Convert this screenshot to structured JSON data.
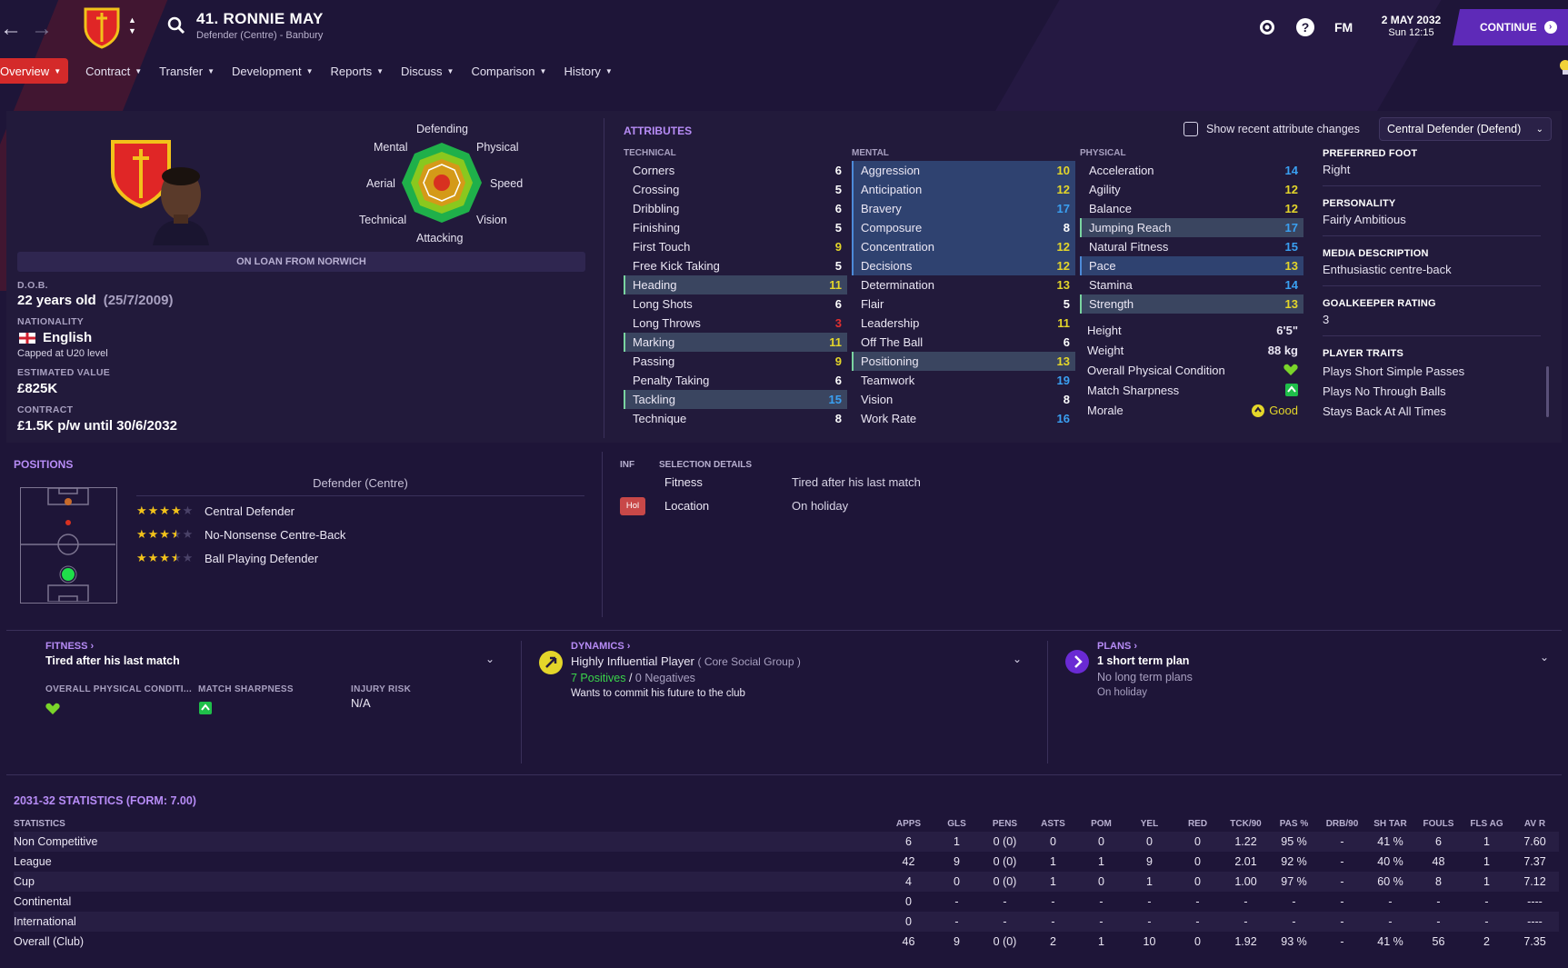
{
  "header": {
    "player_title": "41. RONNIE MAY",
    "player_subtitle": "Defender (Centre) - Banbury",
    "fm_label": "FM",
    "date": "2 MAY 2032",
    "time": "Sun 12:15",
    "continue_label": "CONTINUE"
  },
  "menu": [
    {
      "label": "Overview",
      "active": true
    },
    {
      "label": "Contract"
    },
    {
      "label": "Transfer"
    },
    {
      "label": "Development"
    },
    {
      "label": "Reports"
    },
    {
      "label": "Discuss"
    },
    {
      "label": "Comparison"
    },
    {
      "label": "History"
    }
  ],
  "radar": {
    "labels": {
      "top": "Defending",
      "tl": "Mental",
      "tr": "Physical",
      "l": "Aerial",
      "r": "Speed",
      "bl": "Technical",
      "br": "Vision",
      "bottom": "Attacking"
    }
  },
  "profile": {
    "loan_banner": "ON LOAN FROM NORWICH",
    "dob_label": "D.O.B.",
    "age": "22 years old",
    "dob": "(25/7/2009)",
    "nationality_label": "NATIONALITY",
    "nationality": "English",
    "caps": "Capped at U20 level",
    "value_label": "ESTIMATED VALUE",
    "value": "£825K",
    "contract_label": "CONTRACT",
    "contract": "£1.5K p/w until 30/6/2032"
  },
  "attributes": {
    "title": "ATTRIBUTES",
    "show_changes_label": "Show recent attribute changes",
    "role_select": "Central Defender (Defend)",
    "technical_header": "TECHNICAL",
    "mental_header": "MENTAL",
    "physical_header": "PHYSICAL",
    "technical": [
      {
        "name": "Corners",
        "value": "6",
        "c": "w"
      },
      {
        "name": "Crossing",
        "value": "5",
        "c": "w"
      },
      {
        "name": "Dribbling",
        "value": "6",
        "c": "w"
      },
      {
        "name": "Finishing",
        "value": "5",
        "c": "w"
      },
      {
        "name": "First Touch",
        "value": "9",
        "c": "y"
      },
      {
        "name": "Free Kick Taking",
        "value": "5",
        "c": "w"
      },
      {
        "name": "Heading",
        "value": "11",
        "c": "y",
        "hl": "hl"
      },
      {
        "name": "Long Shots",
        "value": "6",
        "c": "w"
      },
      {
        "name": "Long Throws",
        "value": "3",
        "c": "r"
      },
      {
        "name": "Marking",
        "value": "11",
        "c": "y",
        "hl": "hl"
      },
      {
        "name": "Passing",
        "value": "9",
        "c": "y"
      },
      {
        "name": "Penalty Taking",
        "value": "6",
        "c": "w"
      },
      {
        "name": "Tackling",
        "value": "15",
        "c": "b",
        "hl": "hl"
      },
      {
        "name": "Technique",
        "value": "8",
        "c": "w"
      }
    ],
    "mental": [
      {
        "name": "Aggression",
        "value": "10",
        "c": "y",
        "hl": "hlb"
      },
      {
        "name": "Anticipation",
        "value": "12",
        "c": "y",
        "hl": "hlb"
      },
      {
        "name": "Bravery",
        "value": "17",
        "c": "b",
        "hl": "hlb"
      },
      {
        "name": "Composure",
        "value": "8",
        "c": "w",
        "hl": "hlb"
      },
      {
        "name": "Concentration",
        "value": "12",
        "c": "y",
        "hl": "hlb"
      },
      {
        "name": "Decisions",
        "value": "12",
        "c": "y",
        "hl": "hlb"
      },
      {
        "name": "Determination",
        "value": "13",
        "c": "y"
      },
      {
        "name": "Flair",
        "value": "5",
        "c": "w"
      },
      {
        "name": "Leadership",
        "value": "11",
        "c": "y"
      },
      {
        "name": "Off The Ball",
        "value": "6",
        "c": "w"
      },
      {
        "name": "Positioning",
        "value": "13",
        "c": "y",
        "hl": "hl"
      },
      {
        "name": "Teamwork",
        "value": "19",
        "c": "b"
      },
      {
        "name": "Vision",
        "value": "8",
        "c": "w"
      },
      {
        "name": "Work Rate",
        "value": "16",
        "c": "b"
      }
    ],
    "physical": [
      {
        "name": "Acceleration",
        "value": "14",
        "c": "b"
      },
      {
        "name": "Agility",
        "value": "12",
        "c": "y"
      },
      {
        "name": "Balance",
        "value": "12",
        "c": "y"
      },
      {
        "name": "Jumping Reach",
        "value": "17",
        "c": "b",
        "hl": "hl"
      },
      {
        "name": "Natural Fitness",
        "value": "15",
        "c": "b"
      },
      {
        "name": "Pace",
        "value": "13",
        "c": "y",
        "hl": "hlb"
      },
      {
        "name": "Stamina",
        "value": "14",
        "c": "b"
      },
      {
        "name": "Strength",
        "value": "13",
        "c": "y",
        "hl": "hl"
      }
    ],
    "height_label": "Height",
    "height": "6'5\"",
    "weight_label": "Weight",
    "weight": "88 kg",
    "condition_label": "Overall Physical Condition",
    "sharpness_label": "Match Sharpness",
    "morale_label": "Morale",
    "morale": "Good"
  },
  "info": {
    "foot_label": "PREFERRED FOOT",
    "foot": "Right",
    "personality_label": "PERSONALITY",
    "personality": "Fairly Ambitious",
    "media_label": "MEDIA DESCRIPTION",
    "media": "Enthusiastic centre-back",
    "gk_label": "GOALKEEPER RATING",
    "gk": "3",
    "traits_label": "PLAYER TRAITS",
    "traits": [
      "Plays Short Simple Passes",
      "Plays No Through Balls",
      "Stays Back At All Times"
    ]
  },
  "positions": {
    "title": "POSITIONS",
    "group": "Defender (Centre)",
    "roles": [
      {
        "name": "Central Defender",
        "stars": 4
      },
      {
        "name": "No-Nonsense Centre-Back",
        "stars": 3.5
      },
      {
        "name": "Ball Playing Defender",
        "stars": 3.5
      }
    ]
  },
  "selection": {
    "inf_label": "INF",
    "title": "SELECTION DETAILS",
    "rows": [
      {
        "label": "Fitness",
        "value": "Tired after his last match"
      },
      {
        "label": "Location",
        "value": "On holiday"
      }
    ],
    "hol_badge": "Hol"
  },
  "fitness_card": {
    "title": "FITNESS",
    "headline": "Tired after his last match",
    "opc_label": "OVERALL PHYSICAL CONDITI...",
    "ms_label": "MATCH SHARPNESS",
    "injury_label": "INJURY RISK",
    "injury": "N/A"
  },
  "dynamics_card": {
    "title": "DYNAMICS",
    "headline": "Highly Influential Player",
    "group": "( Core Social Group )",
    "positives": "7 Positives",
    "slash": "/",
    "negatives": "0 Negatives",
    "note": "Wants to commit his future to the club"
  },
  "plans_card": {
    "title": "PLANS",
    "headline": "1 short term plan",
    "line1": "No long term plans",
    "line2": "On holiday"
  },
  "stats": {
    "title": "2031-32 STATISTICS (FORM: 7.00)",
    "columns": [
      "STATISTICS",
      "APPS",
      "GLS",
      "PENS",
      "ASTS",
      "POM",
      "YEL",
      "RED",
      "TCK/90",
      "PAS %",
      "DRB/90",
      "SH TAR",
      "FOULS",
      "FLS AG",
      "AV R"
    ],
    "rows": [
      [
        "Non Competitive",
        "6",
        "1",
        "0 (0)",
        "0",
        "0",
        "0",
        "0",
        "1.22",
        "95 %",
        "-",
        "41 %",
        "6",
        "1",
        "7.60"
      ],
      [
        "League",
        "42",
        "9",
        "0 (0)",
        "1",
        "1",
        "9",
        "0",
        "2.01",
        "92 %",
        "-",
        "40 %",
        "48",
        "1",
        "7.37"
      ],
      [
        "Cup",
        "4",
        "0",
        "0 (0)",
        "1",
        "0",
        "1",
        "0",
        "1.00",
        "97 %",
        "-",
        "60 %",
        "8",
        "1",
        "7.12"
      ],
      [
        "Continental",
        "0",
        "-",
        "-",
        "-",
        "-",
        "-",
        "-",
        "-",
        "-",
        "-",
        "-",
        "-",
        "-",
        "----"
      ],
      [
        "International",
        "0",
        "-",
        "-",
        "-",
        "-",
        "-",
        "-",
        "-",
        "-",
        "-",
        "-",
        "-",
        "-",
        "----"
      ],
      [
        "Overall (Club)",
        "46",
        "9",
        "0 (0)",
        "2",
        "1",
        "10",
        "0",
        "1.92",
        "93 %",
        "-",
        "41 %",
        "56",
        "2",
        "7.35"
      ]
    ]
  }
}
